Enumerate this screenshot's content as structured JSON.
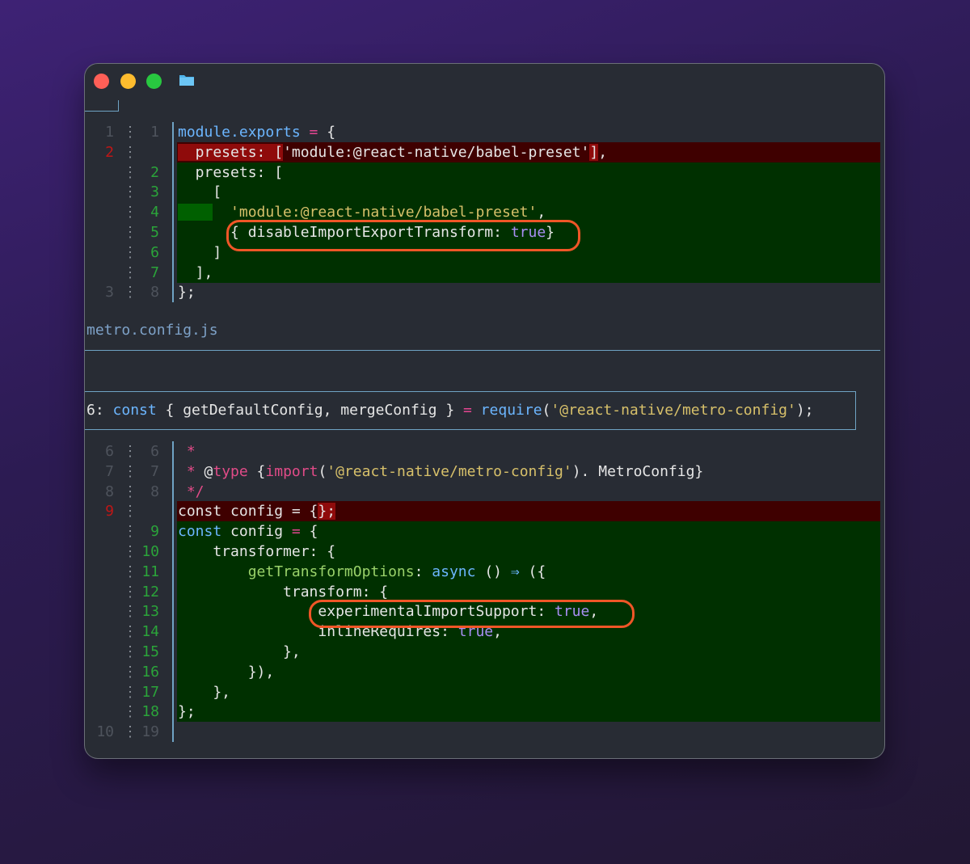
{
  "window": {
    "traffic_lights": [
      "close",
      "minimize",
      "zoom"
    ],
    "folder_icon": "folder-icon",
    "colors": {
      "deleted_bg": "#3f0000",
      "added_bg": "#003000",
      "accent": "#6fa3c4",
      "highlight_oval": "#f05627"
    }
  },
  "file1": {
    "lines": [
      {
        "old": "1",
        "new": "1",
        "type": "ctx",
        "tokens": [
          [
            "c-prop",
            "module.exports"
          ],
          [
            "c-op",
            " = "
          ],
          [
            "",
            "{"
          ]
        ]
      },
      {
        "old": "2",
        "new": "",
        "type": "del",
        "tokens": [
          [
            "hl-del",
            "  presets: "
          ],
          [
            "",
            ""
          ],
          [
            "hl-del",
            "["
          ],
          [
            "",
            "'module:@react-native/babel-preset'"
          ],
          [
            "hl-del",
            "]"
          ],
          [
            "",
            ","
          ]
        ]
      },
      {
        "old": "",
        "new": "2",
        "type": "add",
        "tokens": [
          [
            "",
            "  presets: ["
          ]
        ]
      },
      {
        "old": "",
        "new": "3",
        "type": "add",
        "tokens": [
          [
            "",
            "    ["
          ]
        ]
      },
      {
        "old": "",
        "new": "4",
        "type": "add",
        "tokens": [
          [
            "hl-add",
            "    "
          ],
          [
            "c-str",
            "  'module:@react-native/babel-preset'"
          ],
          [
            "",
            ","
          ]
        ]
      },
      {
        "old": "",
        "new": "5",
        "type": "add",
        "tokens": [
          [
            "",
            "      { disableImportExportTransform: "
          ],
          [
            "c-bool",
            "true"
          ],
          [
            "",
            "}"
          ]
        ]
      },
      {
        "old": "",
        "new": "6",
        "type": "add",
        "tokens": [
          [
            "",
            "    ]"
          ]
        ]
      },
      {
        "old": "",
        "new": "7",
        "type": "add",
        "tokens": [
          [
            "",
            "  ],"
          ]
        ]
      },
      {
        "old": "3",
        "new": "8",
        "type": "ctx",
        "tokens": [
          [
            "",
            "};"
          ]
        ]
      }
    ]
  },
  "filename": "metro.config.js",
  "hunk_header": {
    "prefix": "6: ",
    "tokens": [
      [
        "c-kw",
        "const"
      ],
      [
        "",
        " { getDefaultConfig, mergeConfig } "
      ],
      [
        "c-op",
        "="
      ],
      [
        "c-kw",
        " require"
      ],
      [
        "",
        "("
      ],
      [
        "c-str",
        "'@react-native/metro-config'"
      ],
      [
        "",
        ");"
      ]
    ]
  },
  "file2": {
    "lines": [
      {
        "old": "6",
        "new": "6",
        "type": "ctx",
        "tokens": [
          [
            "c-pink",
            " *"
          ]
        ]
      },
      {
        "old": "7",
        "new": "7",
        "type": "ctx",
        "tokens": [
          [
            "c-pink",
            " * "
          ],
          [
            "",
            "@"
          ],
          [
            "c-pink",
            "type"
          ],
          [
            "",
            " {"
          ],
          [
            "c-pink",
            "import"
          ],
          [
            "",
            "("
          ],
          [
            "c-str",
            "'@react-native/metro-config'"
          ],
          [
            "",
            "). MetroConfig}"
          ]
        ]
      },
      {
        "old": "8",
        "new": "8",
        "type": "ctx",
        "tokens": [
          [
            "c-pink",
            " */"
          ]
        ]
      },
      {
        "old": "9",
        "new": "",
        "type": "del",
        "tokens": [
          [
            "",
            "const config = {"
          ],
          [
            "hl-del",
            "};"
          ]
        ]
      },
      {
        "old": "",
        "new": "9",
        "type": "add",
        "tokens": [
          [
            "c-kw",
            "const"
          ],
          [
            "",
            " config "
          ],
          [
            "c-op",
            "="
          ],
          [
            "",
            " {"
          ]
        ]
      },
      {
        "old": "",
        "new": "10",
        "type": "add",
        "tokens": [
          [
            "",
            "    transformer: {"
          ]
        ]
      },
      {
        "old": "",
        "new": "11",
        "type": "add",
        "tokens": [
          [
            "c-fn",
            "        getTransformOptions"
          ],
          [
            "",
            ": "
          ],
          [
            "c-kw",
            "async"
          ],
          [
            "",
            " () "
          ],
          [
            "c-kw",
            "⇒"
          ],
          [
            "",
            " ({"
          ]
        ]
      },
      {
        "old": "",
        "new": "12",
        "type": "add",
        "tokens": [
          [
            "",
            "            transform: {"
          ]
        ]
      },
      {
        "old": "",
        "new": "13",
        "type": "add",
        "tokens": [
          [
            "",
            "                experimentalImportSupport: "
          ],
          [
            "c-bool",
            "true"
          ],
          [
            "",
            ","
          ]
        ]
      },
      {
        "old": "",
        "new": "14",
        "type": "add",
        "tokens": [
          [
            "",
            "                inlineRequires: "
          ],
          [
            "c-bool",
            "true"
          ],
          [
            "",
            ","
          ]
        ]
      },
      {
        "old": "",
        "new": "15",
        "type": "add",
        "tokens": [
          [
            "",
            "            },"
          ]
        ]
      },
      {
        "old": "",
        "new": "16",
        "type": "add",
        "tokens": [
          [
            "",
            "        }),"
          ]
        ]
      },
      {
        "old": "",
        "new": "17",
        "type": "add",
        "tokens": [
          [
            "",
            "    },"
          ]
        ]
      },
      {
        "old": "",
        "new": "18",
        "type": "add",
        "tokens": [
          [
            "",
            "};"
          ]
        ]
      },
      {
        "old": "10",
        "new": "19",
        "type": "ctx",
        "tokens": []
      }
    ]
  }
}
